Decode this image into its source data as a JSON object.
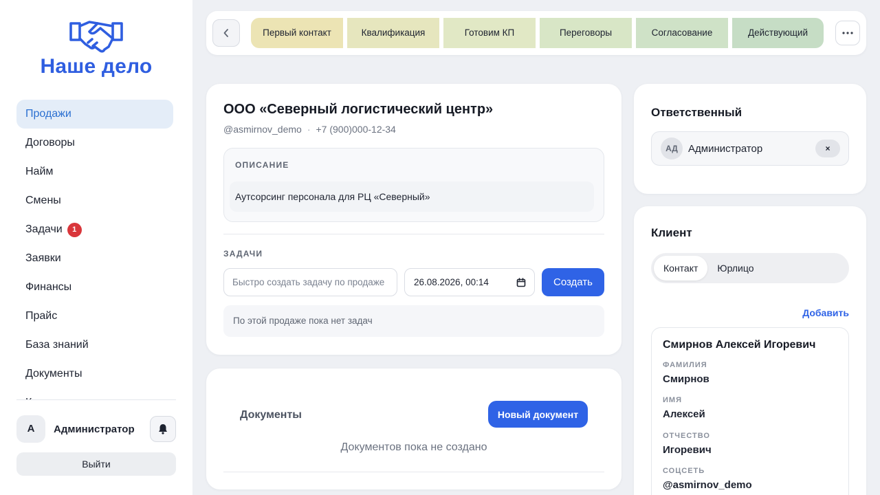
{
  "app": {
    "logo_text": "Наше дело",
    "accent": "#2f63e6"
  },
  "sidebar": {
    "items": [
      {
        "label": "Продажи",
        "active": true
      },
      {
        "label": "Договоры"
      },
      {
        "label": "Найм"
      },
      {
        "label": "Смены"
      },
      {
        "label": "Задачи",
        "badge": "1"
      },
      {
        "label": "Заявки"
      },
      {
        "label": "Финансы"
      },
      {
        "label": "Прайс"
      },
      {
        "label": "База знаний"
      },
      {
        "label": "Документы"
      },
      {
        "label": "К"
      }
    ],
    "user": {
      "avatar_letter": "А",
      "name": "Администратор"
    },
    "logout_label": "Выйти"
  },
  "stages": [
    {
      "label": "Первый контакт",
      "color": "#ece4b4"
    },
    {
      "label": "Квалификация",
      "color": "#e6e6be"
    },
    {
      "label": "Готовим КП",
      "color": "#e1e8c5"
    },
    {
      "label": "Переговоры",
      "color": "#d8e6c6"
    },
    {
      "label": "Согласование",
      "color": "#cfe2c7"
    },
    {
      "label": "Действующий",
      "color": "#c6ddc5"
    }
  ],
  "deal": {
    "title": "ООО «Северный логистический центр»",
    "handle": "@asmirnov_demo",
    "phone": "+7 (900)000-12-34",
    "description_label": "ОПИСАНИЕ",
    "description": "Аутсорсинг персонала для РЦ «Северный»",
    "tasks_label": "ЗАДАЧИ",
    "task_placeholder": "Быстро создать задачу по продаже",
    "task_datetime": "26.08.2026, 00:14",
    "create_label": "Создать",
    "no_tasks_text": "По этой продаже пока нет задач"
  },
  "documents": {
    "title": "Документы",
    "new_label": "Новый документ",
    "empty_text": "Документов пока не создано"
  },
  "responsible": {
    "title": "Ответственный",
    "initials": "АД",
    "name": "Администратор",
    "remove_symbol": "×"
  },
  "client": {
    "title": "Клиент",
    "tabs": [
      {
        "label": "Контакт",
        "active": true
      },
      {
        "label": "Юрлицо"
      }
    ],
    "add_label": "Добавить",
    "contact": {
      "full_name": "Смирнов Алексей Игоревич",
      "fields": [
        {
          "label": "ФАМИЛИЯ",
          "value": "Смирнов"
        },
        {
          "label": "ИМЯ",
          "value": "Алексей"
        },
        {
          "label": "ОТЧЕСТВО",
          "value": "Игоревич"
        },
        {
          "label": "СОЦСЕТЬ",
          "value": "@asmirnov_demo"
        }
      ]
    }
  }
}
